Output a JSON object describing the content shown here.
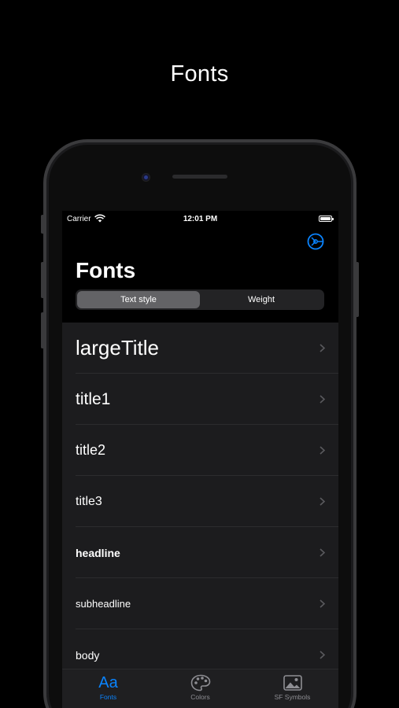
{
  "page": {
    "heading": "Fonts"
  },
  "status_bar": {
    "carrier": "Carrier",
    "time": "12:01 PM"
  },
  "nav": {
    "title": "Fonts",
    "settings_icon": "settings-icon",
    "segments": [
      {
        "label": "Text style",
        "selected": true
      },
      {
        "label": "Weight",
        "selected": false
      }
    ]
  },
  "list": {
    "items": [
      {
        "label": "largeTitle"
      },
      {
        "label": "title1"
      },
      {
        "label": "title2"
      },
      {
        "label": "title3"
      },
      {
        "label": "headline"
      },
      {
        "label": "subheadline"
      },
      {
        "label": "body"
      }
    ]
  },
  "tabs": [
    {
      "label": "Fonts",
      "icon": "Aa",
      "active": true
    },
    {
      "label": "Colors",
      "icon": "palette-icon",
      "active": false
    },
    {
      "label": "SF Symbols",
      "icon": "photo-icon",
      "active": false
    }
  ],
  "colors": {
    "accent": "#0a84ff",
    "list_bg": "#1c1c1e",
    "background": "#000000"
  }
}
